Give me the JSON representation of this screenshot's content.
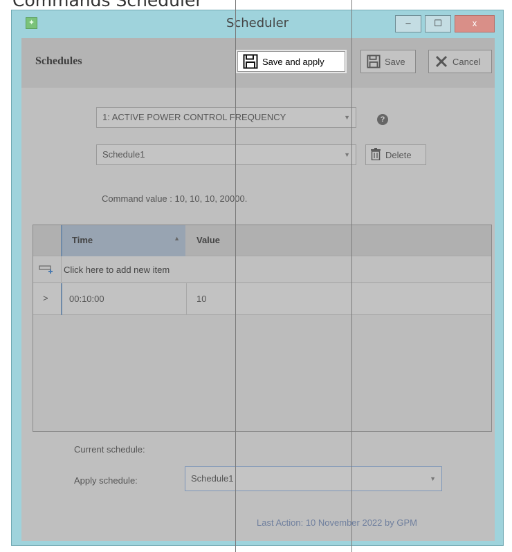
{
  "heading": "Commands Scheduler",
  "window": {
    "title": "Scheduler",
    "controls": {
      "minimize": "–",
      "maximize": "☐",
      "close": "x"
    }
  },
  "toolbar": {
    "section_label": "Schedules",
    "save_apply_label": "Save and apply",
    "save_label": "Save",
    "cancel_label": "Cancel"
  },
  "form": {
    "command_select": "1: ACTIVE POWER CONTROL FREQUENCY",
    "schedule_select": "Schedule1",
    "delete_label": "Delete",
    "command_value_text": "Command value : 10, 10, 10, 20000."
  },
  "grid": {
    "columns": [
      "Time",
      "Value"
    ],
    "add_item_text": "Click here to add new item",
    "rows": [
      {
        "time": "00:10:00",
        "value": "10"
      }
    ]
  },
  "footer": {
    "current_schedule_label": "Current schedule:",
    "apply_schedule_label": "Apply schedule:",
    "apply_schedule_value": "Schedule1",
    "last_action": "Last Action: 10 November 2022 by GPM"
  },
  "colors": {
    "title_bar": "#9fd3dc",
    "overlay_gray": "#bfbfbf",
    "close_button": "#d98f88",
    "highlight": "#ffffff"
  }
}
